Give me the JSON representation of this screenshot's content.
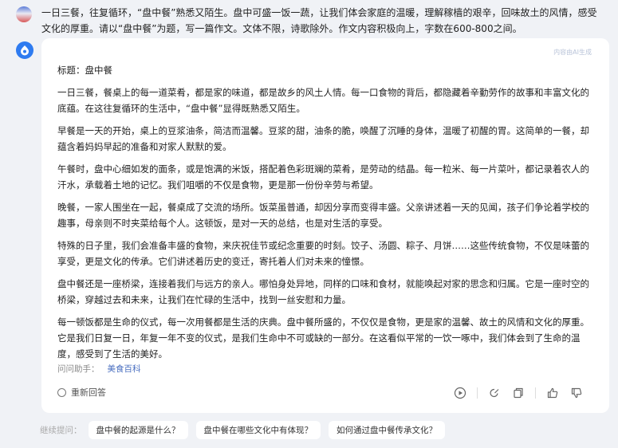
{
  "user": {
    "prompt": "一日三餐，往复循环，“盘中餐”熟悉又陌生。盘中可盛一饭一蔬，让我们体会家庭的温暖，理解稼樯的艰辛，回味故土的风情，感受文化的厚重。请以“盘中餐”为题，写一篇作文。文体不限，诗歌除外。作文内容积极向上，字数在600-800之间。"
  },
  "answer": {
    "watermark": "内容由AI生成",
    "title": "标题：盘中餐",
    "paragraphs": [
      "一日三餐，餐桌上的每一道菜肴，都是家的味道，都是故乡的风土人情。每一口食物的背后，都隐藏着辛勤劳作的故事和丰富文化的底蕴。在这往复循环的生活中，“盘中餐”显得既熟悉又陌生。",
      "早餐是一天的开始，桌上的豆浆油条，简洁而温馨。豆浆的甜，油条的脆，唤醒了沉睡的身体，温暖了初醒的胃。这简单的一餐，却蕴含着妈妈早起的准备和对家人默默的爱。",
      "午餐时，盘中心细如发的面条，或是饱满的米饭，搭配着色彩斑斓的菜肴，是劳动的结晶。每一粒米、每一片菜叶，都记录着农人的汗水，承载着土地的记忆。我们咀嚼的不仅是食物，更是那一份份辛劳与希望。",
      "晚餐，一家人围坐在一起，餐桌成了交流的场所。饭菜虽普通，却因分享而变得丰盛。父亲讲述着一天的见闻，孩子们争论着学校的趣事，母亲则不时夹菜给每个人。这顿饭，是对一天的总结，也是对生活的享受。",
      "特殊的日子里，我们会准备丰盛的食物，来庆祝佳节或纪念重要的时刻。饺子、汤圆、粽子、月饼……这些传统食物，不仅是味蕾的享受，更是文化的传承。它们讲述着历史的变迁，寄托着人们对未来的憧憬。",
      "盘中餐还是一座桥梁，连接着我们与远方的亲人。哪怕身处异地，同样的口味和食材，就能唤起对家的思念和归属。它是一座时空的桥梁，穿越过去和未来，让我们在忙碌的生活中，找到一丝安慰和力量。",
      "每一顿饭都是生命的仪式，每一次用餐都是生活的庆典。盘中餐所盛的，不仅仅是食物，更是家的温馨、故土的风情和文化的厚重。它是我们日复一日，年复一年不变的仪式，是我们生命中不可或缺的一部分。在这看似平常的一饮一啄中，我们体会到了生命的温度，感受到了生活的美好。"
    ],
    "sources_label": "问问助手：",
    "sources_link": "美食百科",
    "regenerate_label": "重新回答"
  },
  "icons": {
    "play": "play-icon",
    "edit": "edit-icon",
    "copy": "copy-icon",
    "like": "thumbs-up-icon",
    "dislike": "thumbs-down-icon"
  },
  "colors": {
    "accent": "#2e7bf0",
    "link": "#4a6fc0",
    "background": "#f0f2f6"
  },
  "followups": {
    "label": "继续提问：",
    "items": [
      "盘中餐的起源是什么？",
      "盘中餐在哪些文化中有体现？",
      "如何通过盘中餐传承文化？"
    ]
  }
}
